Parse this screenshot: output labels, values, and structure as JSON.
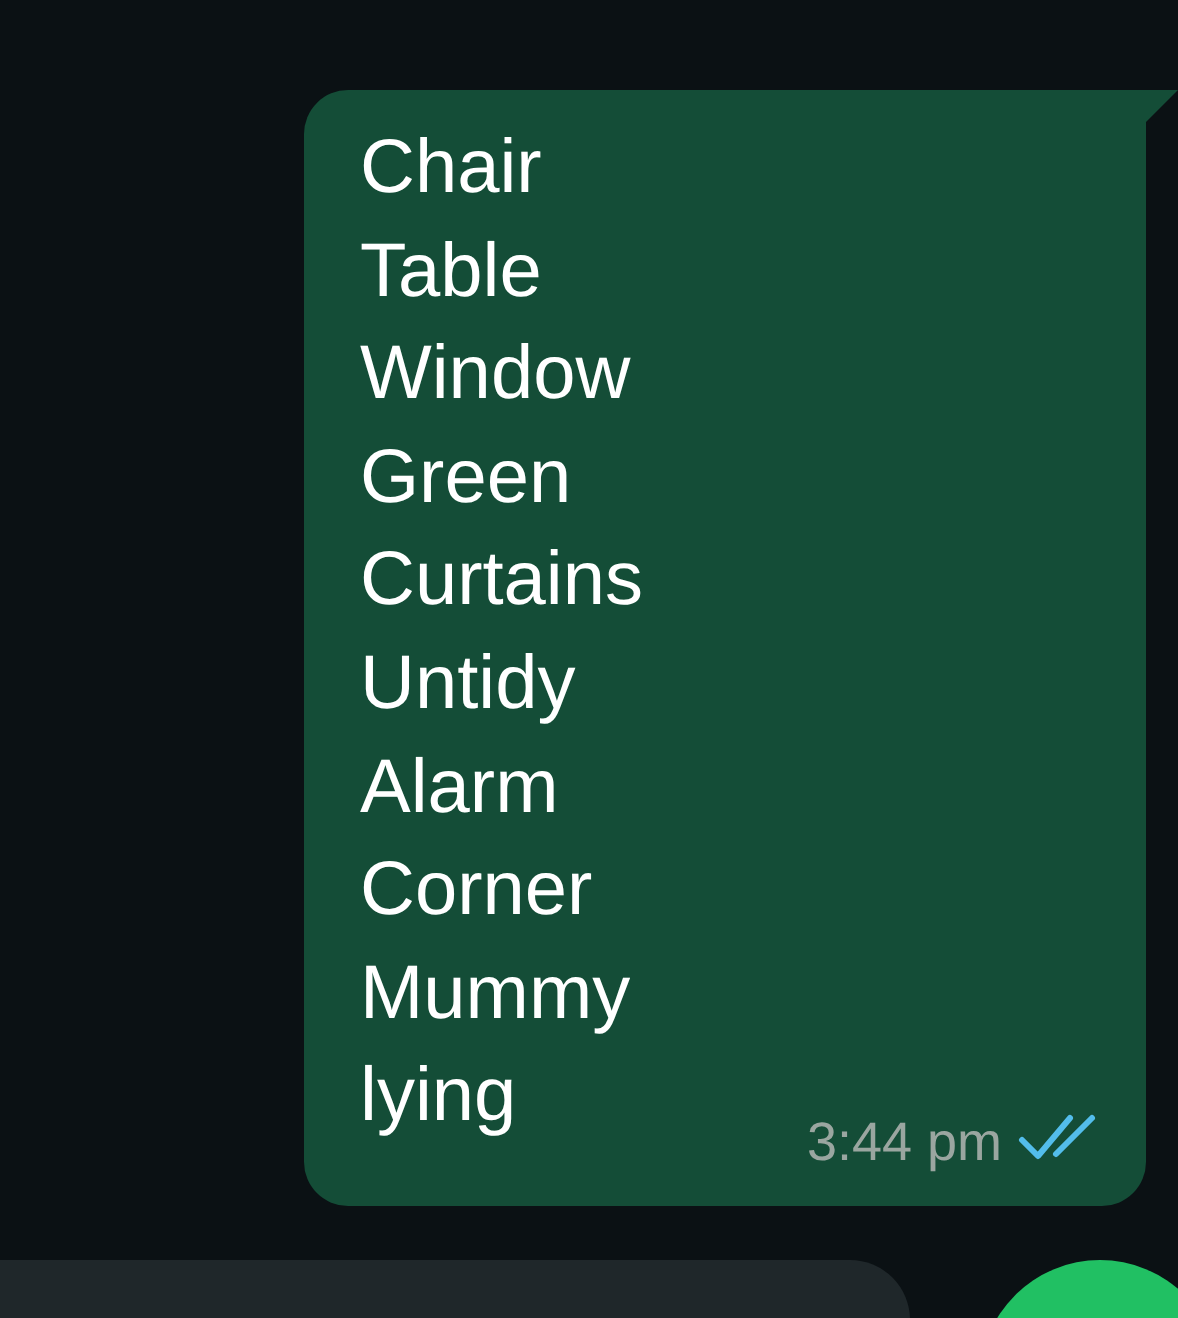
{
  "message": {
    "text": "Chair\nTable\nWindow\nGreen\nCurtains\nUntidy\nAlarm\nCorner\nMummy\nlying",
    "time": "3:44 pm",
    "read": true
  }
}
